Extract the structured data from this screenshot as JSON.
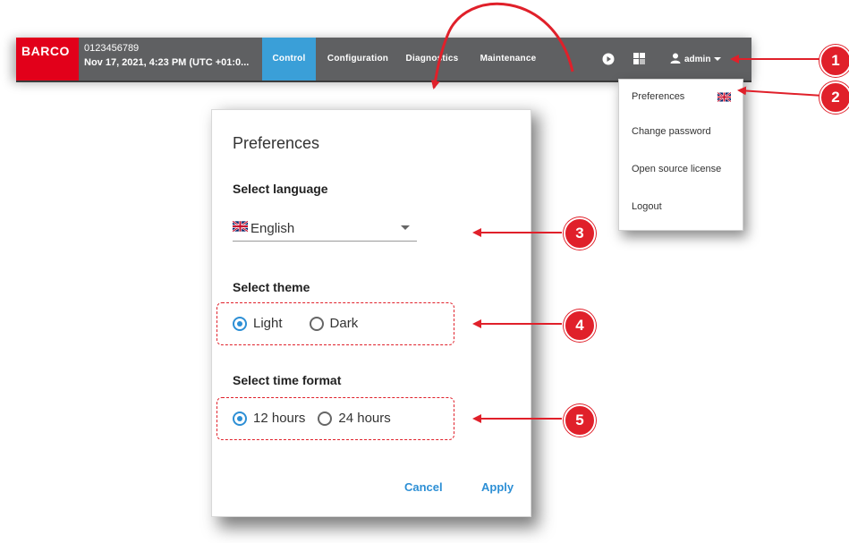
{
  "topbar": {
    "logo": "BARCO",
    "device_id": "0123456789",
    "device_date": "Nov 17, 2021, 4:23 PM (UTC +01:0...",
    "tabs": [
      {
        "label": "Control",
        "active": true
      },
      {
        "label": "Configuration",
        "active": false
      },
      {
        "label": "Diagnostics",
        "active": false
      },
      {
        "label": "Maintenance",
        "active": false
      }
    ],
    "icons": [
      "play-icon",
      "layout-icon",
      "user-icon",
      "caret-down-icon"
    ],
    "user": "admin"
  },
  "menu": {
    "items": [
      "Preferences",
      "Change password",
      "Open source license",
      "Logout"
    ]
  },
  "dialog": {
    "title": "Preferences",
    "language": {
      "label": "Select language",
      "value": "English"
    },
    "theme": {
      "label": "Select theme",
      "options": [
        "Light",
        "Dark"
      ],
      "selected": "Light"
    },
    "time_format": {
      "label": "Select time format",
      "options": [
        "12 hours",
        "24 hours"
      ],
      "selected": "12 hours"
    },
    "buttons": {
      "cancel": "Cancel",
      "apply": "Apply"
    }
  },
  "callouts": [
    "1",
    "2",
    "3",
    "4",
    "5"
  ],
  "colors": {
    "accent": "#3a9fd8",
    "brand": "#e2001a",
    "callout": "#e0202a",
    "topbar": "#5f6062"
  }
}
